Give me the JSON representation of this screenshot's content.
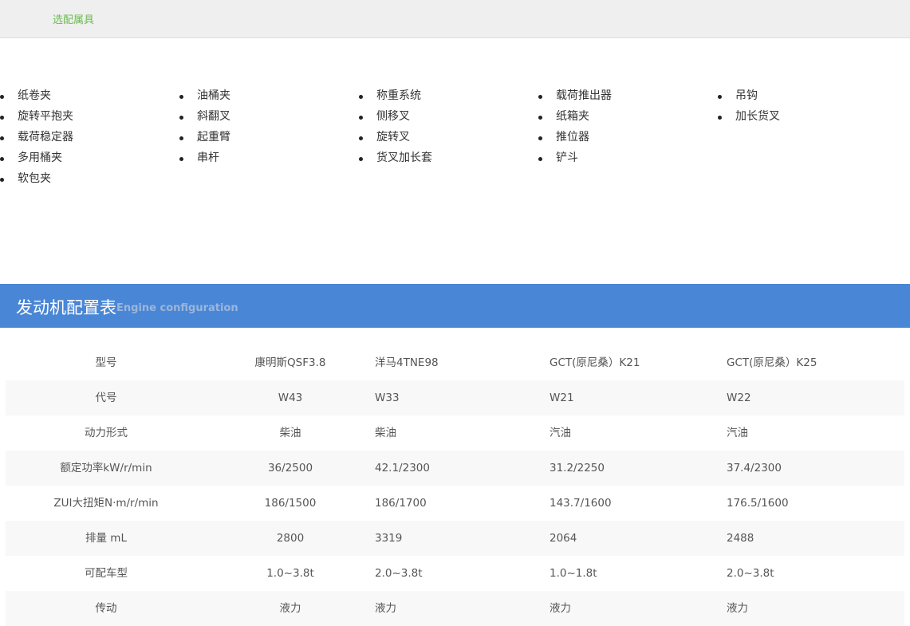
{
  "top_tab": {
    "label": "选配属具"
  },
  "accessories": {
    "columns": [
      [
        "纸卷夹",
        "旋转平抱夹",
        "载荷稳定器",
        "多用桶夹",
        "软包夹"
      ],
      [
        "油桶夹",
        "斜翻叉",
        "起重臂",
        "串杆"
      ],
      [
        "称重系统",
        "侧移叉",
        "旋转叉",
        "货叉加长套"
      ],
      [
        "载荷推出器",
        "纸箱夹",
        "推位器",
        "铲斗"
      ],
      [
        "吊钩",
        "加长货叉"
      ]
    ]
  },
  "engine_section": {
    "title": "发动机配置表",
    "subtitle": "Engine configuration"
  },
  "spec_table": {
    "rows": [
      [
        "型号",
        "康明斯QSF3.8",
        "洋马4TNE98",
        "GCT(原尼桑）K21",
        "GCT(原尼桑）K25"
      ],
      [
        "代号",
        "W43",
        "W33",
        "W21",
        "W22"
      ],
      [
        "动力形式",
        "柴油",
        "柴油",
        "汽油",
        "汽油"
      ],
      [
        "额定功率kW/r/min",
        "36/2500",
        "42.1/2300",
        "31.2/2250",
        "37.4/2300"
      ],
      [
        "ZUI大扭矩N·m/r/min",
        "186/1500",
        "186/1700",
        "143.7/1600",
        "176.5/1600"
      ],
      [
        "排量 mL",
        "2800",
        "3319",
        "2064",
        "2488"
      ],
      [
        "可配车型",
        "1.0~3.8t",
        "2.0~3.8t",
        "1.0~1.8t",
        "2.0~3.8t"
      ],
      [
        "传动",
        "液力",
        "液力",
        "液力",
        "液力"
      ]
    ]
  }
}
